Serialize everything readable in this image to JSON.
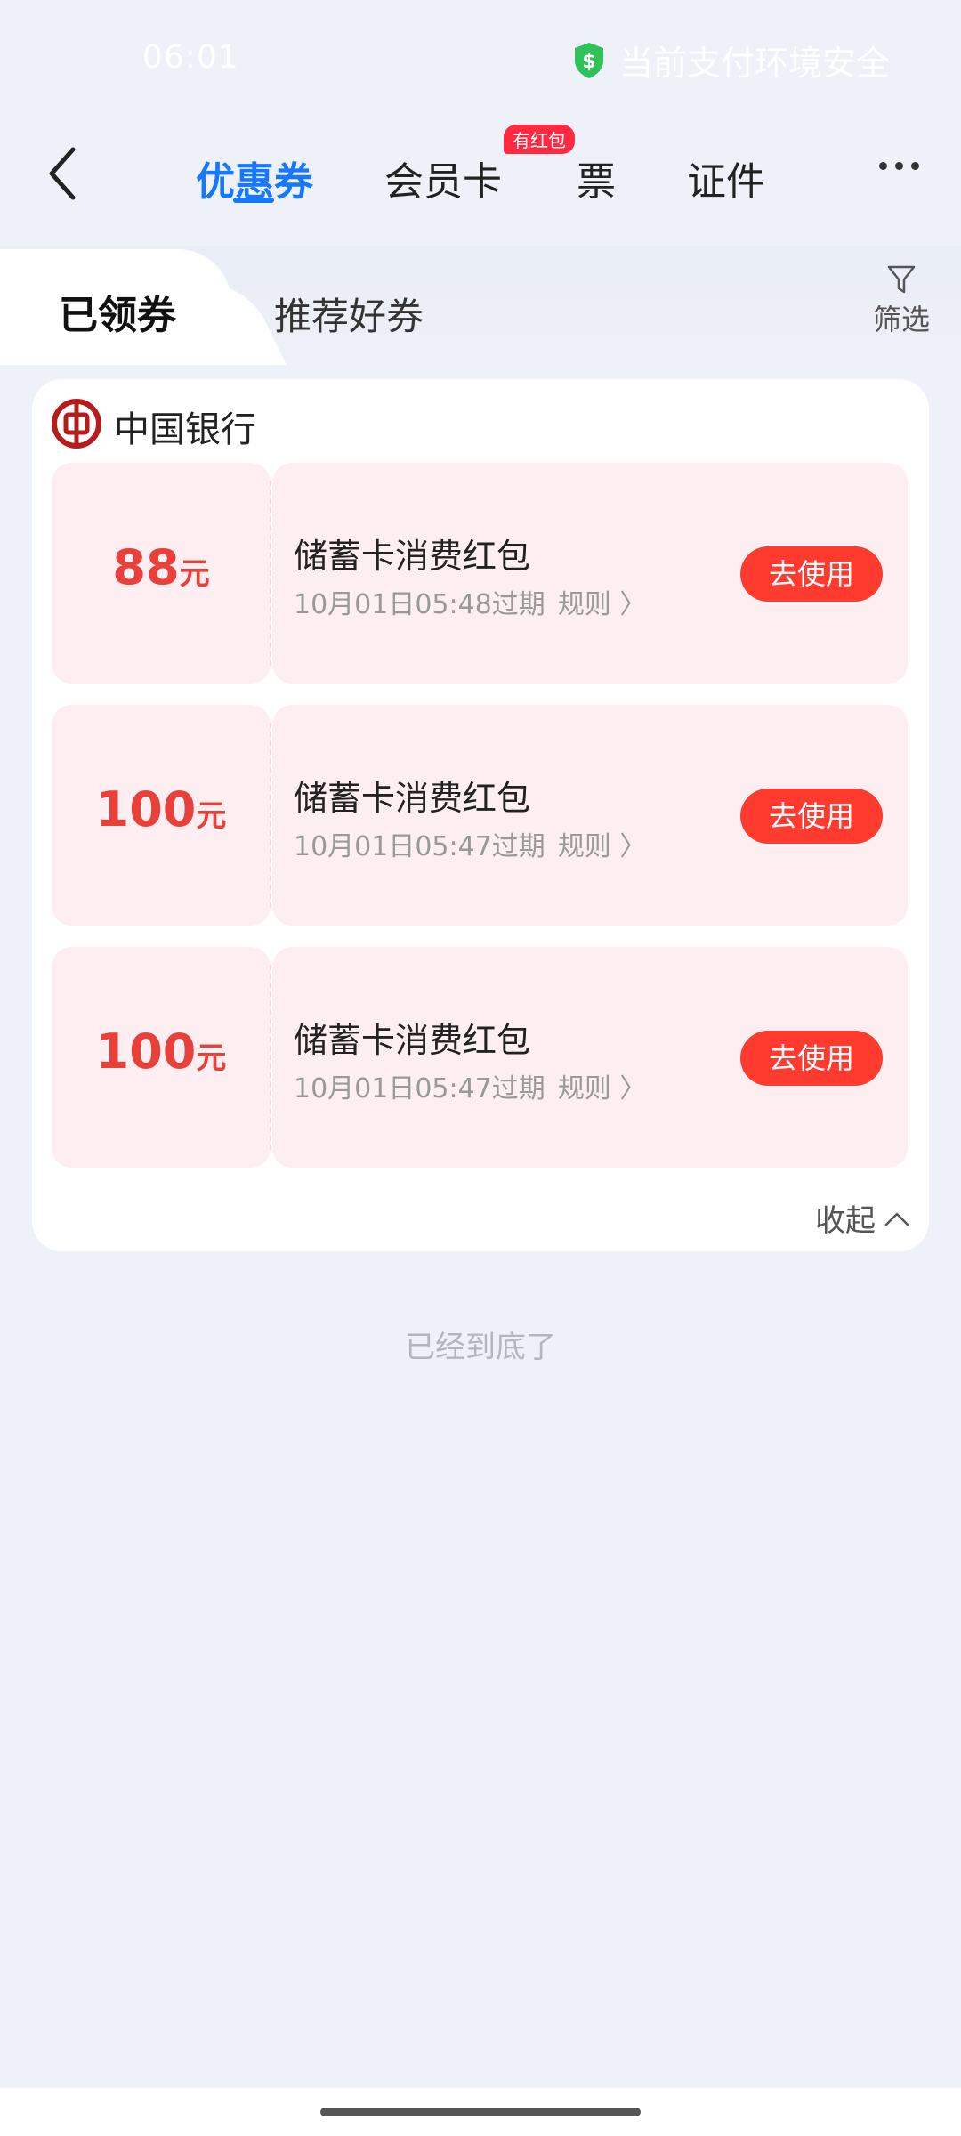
{
  "status_bar": {
    "time": "06:01",
    "security_text": "当前支付环境安全",
    "security_icon": "shield-dollar-icon",
    "security_icon_color": "#2fc25b"
  },
  "top_nav": {
    "tabs": [
      {
        "label": "优惠券",
        "active": true
      },
      {
        "label": "会员卡"
      },
      {
        "label": "票"
      },
      {
        "label": "证件"
      }
    ],
    "badge": "有红包",
    "accent_color": "#1677ff"
  },
  "sub_tabs": {
    "received": "已领券",
    "recommend": "推荐好券",
    "filter_label": "筛选"
  },
  "bank": {
    "name": "中国银行",
    "logo_color": "#b71c1c"
  },
  "coupons": [
    {
      "amount": "88",
      "unit": "元",
      "title": "储蓄卡消费红包",
      "expire": "10月01日05:48过期",
      "rule": "规则",
      "button": "去使用"
    },
    {
      "amount": "100",
      "unit": "元",
      "title": "储蓄卡消费红包",
      "expire": "10月01日05:47过期",
      "rule": "规则",
      "button": "去使用"
    },
    {
      "amount": "100",
      "unit": "元",
      "title": "储蓄卡消费红包",
      "expire": "10月01日05:47过期",
      "rule": "规则",
      "button": "去使用"
    }
  ],
  "collapse_label": "收起",
  "bottom_hint": "已经到底了"
}
